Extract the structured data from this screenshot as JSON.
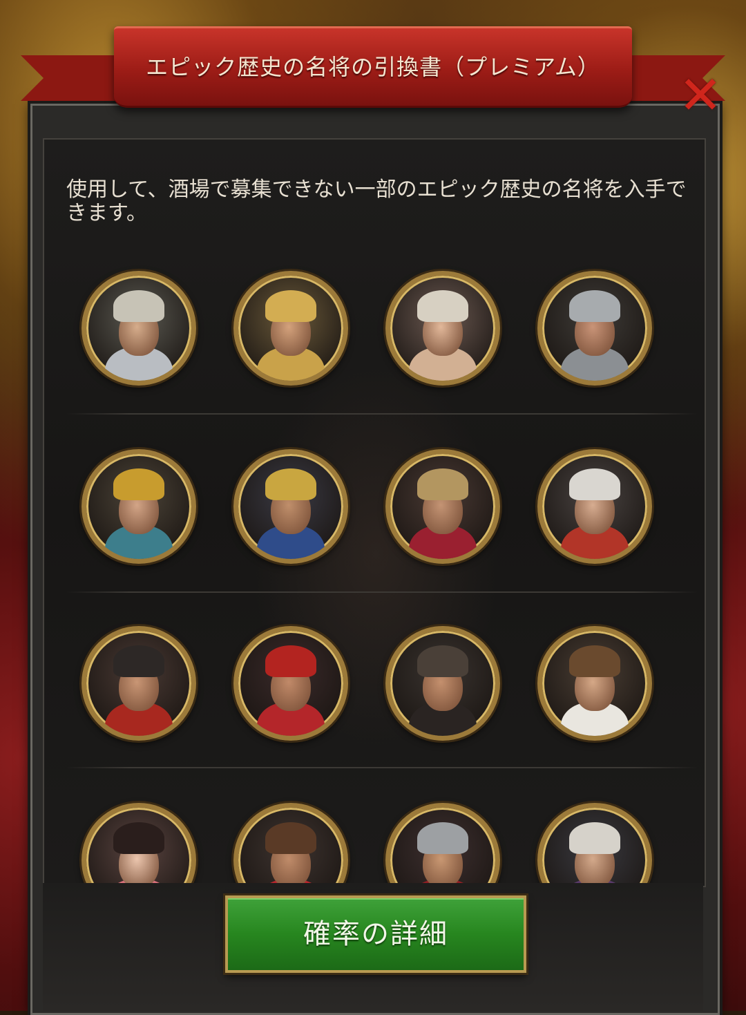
{
  "header": {
    "title": "エピック歴史の名将の引換書（プレミアム）",
    "close_glyph": "✕"
  },
  "description": "使用して、酒場で募集できない一部のエピック歴史の名将を入手できます。",
  "generals": [
    {
      "name": "general-portrait-1",
      "bg": "#5b5a52",
      "skin": "#d6ad8c",
      "body": "#b9bdc2",
      "helm": "#c7c3b6"
    },
    {
      "name": "general-portrait-2",
      "bg": "#6b5a3a",
      "skin": "#d4a27c",
      "body": "#c9a24a",
      "helm": "#d3ad52"
    },
    {
      "name": "general-portrait-3",
      "bg": "#6c5a52",
      "skin": "#e2b89a",
      "body": "#d2b093",
      "helm": "#d7d0c2"
    },
    {
      "name": "general-portrait-4",
      "bg": "#3f3c38",
      "skin": "#c99478",
      "body": "#8b8f93",
      "helm": "#a7abae"
    },
    {
      "name": "general-portrait-5",
      "bg": "#4c4438",
      "skin": "#d3a587",
      "body": "#3d7e8c",
      "helm": "#c89c2e"
    },
    {
      "name": "general-portrait-6",
      "bg": "#3a3a44",
      "skin": "#c08f6b",
      "body": "#2f4c8a",
      "helm": "#c9a640"
    },
    {
      "name": "general-portrait-7",
      "bg": "#4a3a34",
      "skin": "#c49474",
      "body": "#9a2030",
      "helm": "#b39660"
    },
    {
      "name": "general-portrait-8",
      "bg": "#4a4442",
      "skin": "#d7ad91",
      "body": "#b23528",
      "helm": "#d9d6d0"
    },
    {
      "name": "general-portrait-9",
      "bg": "#4a3a34",
      "skin": "#c99675",
      "body": "#a8281f",
      "helm": "#2d2826"
    },
    {
      "name": "general-portrait-10",
      "bg": "#3a2a2a",
      "skin": "#c18a69",
      "body": "#b4262a",
      "helm": "#b32420"
    },
    {
      "name": "general-portrait-11",
      "bg": "#3a3430",
      "skin": "#c4906e",
      "body": "#2a2422",
      "helm": "#4a4038"
    },
    {
      "name": "general-portrait-12",
      "bg": "#4a3e34",
      "skin": "#d5a887",
      "body": "#e9e6df",
      "helm": "#6a4a2e"
    },
    {
      "name": "general-portrait-13",
      "bg": "#5a4440",
      "skin": "#ecc6ae",
      "body": "#d8707a",
      "helm": "#2a1e1c"
    },
    {
      "name": "general-portrait-14",
      "bg": "#3e3430",
      "skin": "#c08c6a",
      "body": "#b6262c",
      "helm": "#5a3a26"
    },
    {
      "name": "general-portrait-15",
      "bg": "#3e3030",
      "skin": "#c99873",
      "body": "#8e1f24",
      "helm": "#9da0a3"
    },
    {
      "name": "general-portrait-16",
      "bg": "#3a3a40",
      "skin": "#d4aa8c",
      "body": "#5a3a6a",
      "helm": "#d6d2ca"
    }
  ],
  "button": {
    "label": "確率の詳細"
  }
}
